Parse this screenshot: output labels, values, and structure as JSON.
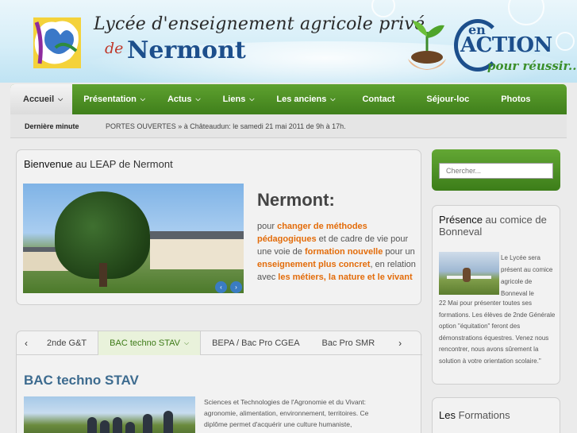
{
  "header": {
    "title_line1": "Lycée d'enseignement agricole privé",
    "title_de": "de",
    "title_name": "Nermont",
    "slogan_en": "en",
    "slogan_action": "ACTION",
    "slogan_pour": "pour réussir..."
  },
  "nav": {
    "items": [
      {
        "label": "Accueil",
        "chevron": true
      },
      {
        "label": "Présentation",
        "chevron": true
      },
      {
        "label": "Actus",
        "chevron": true
      },
      {
        "label": "Liens",
        "chevron": true
      },
      {
        "label": "Les anciens",
        "chevron": true
      },
      {
        "label": "Contact",
        "chevron": false
      },
      {
        "label": "Séjour-loc",
        "chevron": false
      },
      {
        "label": "Photos",
        "chevron": false
      }
    ],
    "chevron_glyph": "⌵"
  },
  "news": {
    "label": "Dernière minute",
    "text": "PORTES OUVERTES » à Châteaudun: le samedi 21 mai 2011 de 9h à 17h."
  },
  "welcome": {
    "title_strong": "Bienvenue",
    "title_rest": " au LEAP de Nermont",
    "slide_heading": "Nermont:",
    "text_1": "pour ",
    "hl_1": "changer de méthodes pédagogiques",
    "text_2": " et de cadre de vie pour une voie de ",
    "hl_2": "formation nouvelle",
    "text_3": " pour un ",
    "hl_3": "enseignement plus concret",
    "text_4": ", en relation avec ",
    "hl_4": "les métiers, la nature et le vivant",
    "prev": "‹",
    "next": "›"
  },
  "tabs": {
    "prev": "‹",
    "next": "›",
    "items": [
      "2nde G&T",
      "BAC techno STAV",
      "BEPA / Bac Pro CGEA",
      "Bac Pro SMR"
    ],
    "active_chevron": "⌵",
    "content_title": "BAC techno STAV",
    "content_text": "Sciences et Technologies de l'Agronomie et du Vivant: agronomie, alimentation, environnement, territoires. Ce diplôme permet d'acquérir une culture humaniste,"
  },
  "sidebar": {
    "search_placeholder": "Chercher...",
    "presence_title_strong": "Présence",
    "presence_title_rest": " au comice de Bonneval",
    "presence_text_a": "Le Lycée sera présent au comice agricole de Bonneval le",
    "presence_text_b": "22 Mai pour présenter toutes ses formations. Les élèves de 2nde Générale option \"équitation\" feront des démonstrations équestres. Venez nous rencontrer, nous avons sûrement la solution à votre orientation scolaire.\"",
    "formations_title_strong": "Les",
    "formations_title_rest": " Formations"
  },
  "colors": {
    "nav_green": "#4e9124",
    "highlight_orange": "#e36c0a",
    "title_blue": "#1d4f8c"
  }
}
